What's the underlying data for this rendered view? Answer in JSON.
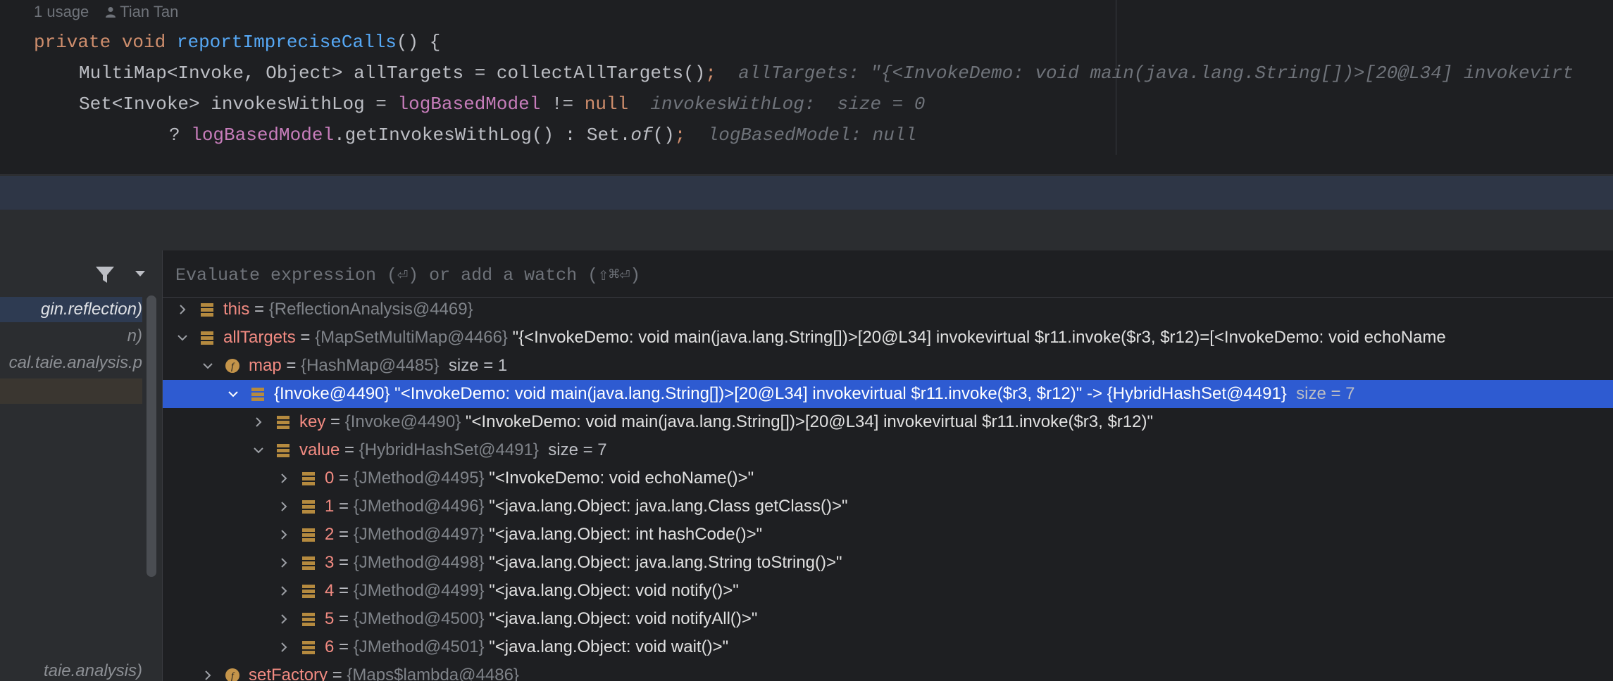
{
  "editor": {
    "hint_usage": "1 usage",
    "hint_author": "Tian Tan",
    "line1": {
      "kw1": "private",
      "kw2": "void",
      "method": "reportImpreciseCalls",
      "rest": "() {"
    },
    "line2": {
      "code": "MultiMap<Invoke, Object> allTargets = collectAllTargets()",
      "semi": ";",
      "inline": "allTargets: \"{<InvokeDemo: void main(java.lang.String[])>[20@L34] invokevirt"
    },
    "line3": {
      "code1": "Set<Invoke> invokesWithLog = ",
      "field": "logBasedModel",
      "code2": " != ",
      "kw": "null",
      "inline": "invokesWithLog:  size = 0"
    },
    "line4": {
      "prefix": "? ",
      "field": "logBasedModel",
      "code1": ".getInvokesWithLog() : Set.",
      "ital": "of",
      "code2": "()",
      "semi": ";",
      "inline": "logBasedModel: null"
    }
  },
  "frames": {
    "items": [
      {
        "label": "gin.reflection)"
      },
      {
        "label": "n)"
      },
      {
        "label": "cal.taie.analysis.p"
      },
      {
        "label": ""
      },
      {
        "label": "taie.analysis)"
      }
    ]
  },
  "evaluate": {
    "placeholder": "Evaluate expression (⏎) or add a watch (⇧⌘⏎)"
  },
  "variables": {
    "rows": [
      {
        "name": "this",
        "eq": " = ",
        "type": "{ReflectionAnalysis@4469}",
        "value": "",
        "size": ""
      },
      {
        "name": "allTargets",
        "eq": " = ",
        "type": "{MapSetMultiMap@4466}",
        "value": " \"{<InvokeDemo: void main(java.lang.String[])>[20@L34] invokevirtual $r11.invoke($r3, $r12)=[<InvokeDemo: void echoName",
        "size": ""
      },
      {
        "name": "map",
        "eq": " = ",
        "type": "{HashMap@4485}",
        "value": "",
        "size": "  size = 1"
      },
      {
        "name": "",
        "eq": "",
        "type": "{Invoke@4490}",
        "value": " \"<InvokeDemo: void main(java.lang.String[])>[20@L34] invokevirtual $r11.invoke($r3, $r12)\" -> {HybridHashSet@4491}",
        "size": "  size = 7"
      },
      {
        "name": "key",
        "eq": " = ",
        "type": "{Invoke@4490}",
        "value": " \"<InvokeDemo: void main(java.lang.String[])>[20@L34] invokevirtual $r11.invoke($r3, $r12)\"",
        "size": ""
      },
      {
        "name": "value",
        "eq": " = ",
        "type": "{HybridHashSet@4491}",
        "value": "",
        "size": "  size = 7"
      },
      {
        "name": "0",
        "eq": " = ",
        "type": "{JMethod@4495}",
        "value": " \"<InvokeDemo: void echoName()>\"",
        "size": ""
      },
      {
        "name": "1",
        "eq": " = ",
        "type": "{JMethod@4496}",
        "value": " \"<java.lang.Object: java.lang.Class getClass()>\"",
        "size": ""
      },
      {
        "name": "2",
        "eq": " = ",
        "type": "{JMethod@4497}",
        "value": " \"<java.lang.Object: int hashCode()>\"",
        "size": ""
      },
      {
        "name": "3",
        "eq": " = ",
        "type": "{JMethod@4498}",
        "value": " \"<java.lang.Object: java.lang.String toString()>\"",
        "size": ""
      },
      {
        "name": "4",
        "eq": " = ",
        "type": "{JMethod@4499}",
        "value": " \"<java.lang.Object: void notify()>\"",
        "size": ""
      },
      {
        "name": "5",
        "eq": " = ",
        "type": "{JMethod@4500}",
        "value": " \"<java.lang.Object: void notifyAll()>\"",
        "size": ""
      },
      {
        "name": "6",
        "eq": " = ",
        "type": "{JMethod@4501}",
        "value": " \"<java.lang.Object: void wait()>\"",
        "size": ""
      },
      {
        "name": "setFactory",
        "eq": " = ",
        "type": "{Maps$lambda@4486}",
        "value": "",
        "size": ""
      }
    ]
  },
  "colors": {
    "selection": "#2e5bd1",
    "field_icon": "#c4944a",
    "object_icon": "#b58a3f"
  }
}
